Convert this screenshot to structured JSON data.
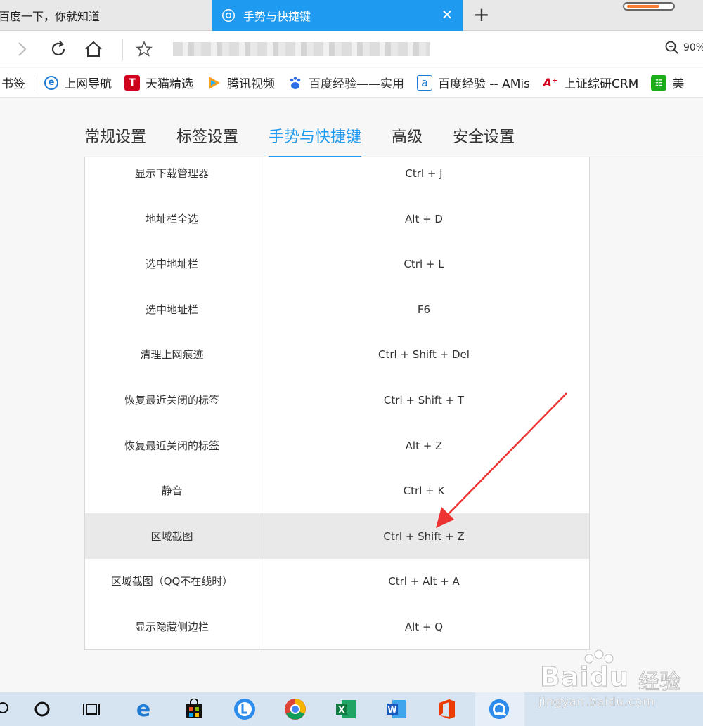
{
  "browser": {
    "tabs": [
      {
        "label": "百度一下，你就知道",
        "active": false
      },
      {
        "label": "手势与快捷键",
        "active": true
      }
    ],
    "new_tab_symbol": "+",
    "close_symbol": "✕",
    "zoom_level": "90%",
    "accent_color": "#1e9af0"
  },
  "bookmarks": [
    {
      "label": "书签",
      "icon": "none"
    },
    {
      "label": "上网导航",
      "icon": "ie-icon"
    },
    {
      "label": "天猫精选",
      "icon": "tmall-icon"
    },
    {
      "label": "腾讯视频",
      "icon": "tencent-video-icon"
    },
    {
      "label": "百度经验——实用",
      "icon": "baidu-paw-icon"
    },
    {
      "label": "百度经验 -- AMis",
      "icon": "letter-a-icon"
    },
    {
      "label": "上证综研CRM",
      "icon": "crm-icon"
    },
    {
      "label": "美",
      "icon": "sheet-icon"
    }
  ],
  "settings_tabs": [
    {
      "label": "常规设置",
      "active": false
    },
    {
      "label": "标签设置",
      "active": false
    },
    {
      "label": "手势与快捷键",
      "active": true
    },
    {
      "label": "高级",
      "active": false
    },
    {
      "label": "安全设置",
      "active": false
    }
  ],
  "shortcuts": [
    {
      "action": "显示下载管理器",
      "keys": "Ctrl + J",
      "highlighted": false
    },
    {
      "action": "地址栏全选",
      "keys": "Alt + D",
      "highlighted": false
    },
    {
      "action": "选中地址栏",
      "keys": "Ctrl + L",
      "highlighted": false
    },
    {
      "action": "选中地址栏",
      "keys": "F6",
      "highlighted": false
    },
    {
      "action": "清理上网痕迹",
      "keys": "Ctrl + Shift + Del",
      "highlighted": false
    },
    {
      "action": "恢复最近关闭的标签",
      "keys": "Ctrl + Shift + T",
      "highlighted": false
    },
    {
      "action": "恢复最近关闭的标签",
      "keys": "Alt + Z",
      "highlighted": false
    },
    {
      "action": "静音",
      "keys": "Ctrl + K",
      "highlighted": false
    },
    {
      "action": "区域截图",
      "keys": "Ctrl + Shift + Z",
      "highlighted": true
    },
    {
      "action": "区域截图（QQ不在线时）",
      "keys": "Ctrl + Alt + A",
      "highlighted": false
    },
    {
      "action": "显示隐藏侧边栏",
      "keys": "Alt + Q",
      "highlighted": false
    }
  ],
  "annotation_arrow_color": "#ee3333",
  "taskbar": {
    "apps": [
      "search-icon",
      "cortana-icon",
      "task-view-icon",
      "edge-icon",
      "store-icon",
      "l-app-icon",
      "chrome-icon",
      "excel-icon",
      "word-icon",
      "office-icon",
      "browser-icon"
    ]
  },
  "watermark": {
    "logo_text": "Bai",
    "logo_text_2": "du",
    "cn_text": "经验",
    "url": "jingyan.baidu.com"
  }
}
